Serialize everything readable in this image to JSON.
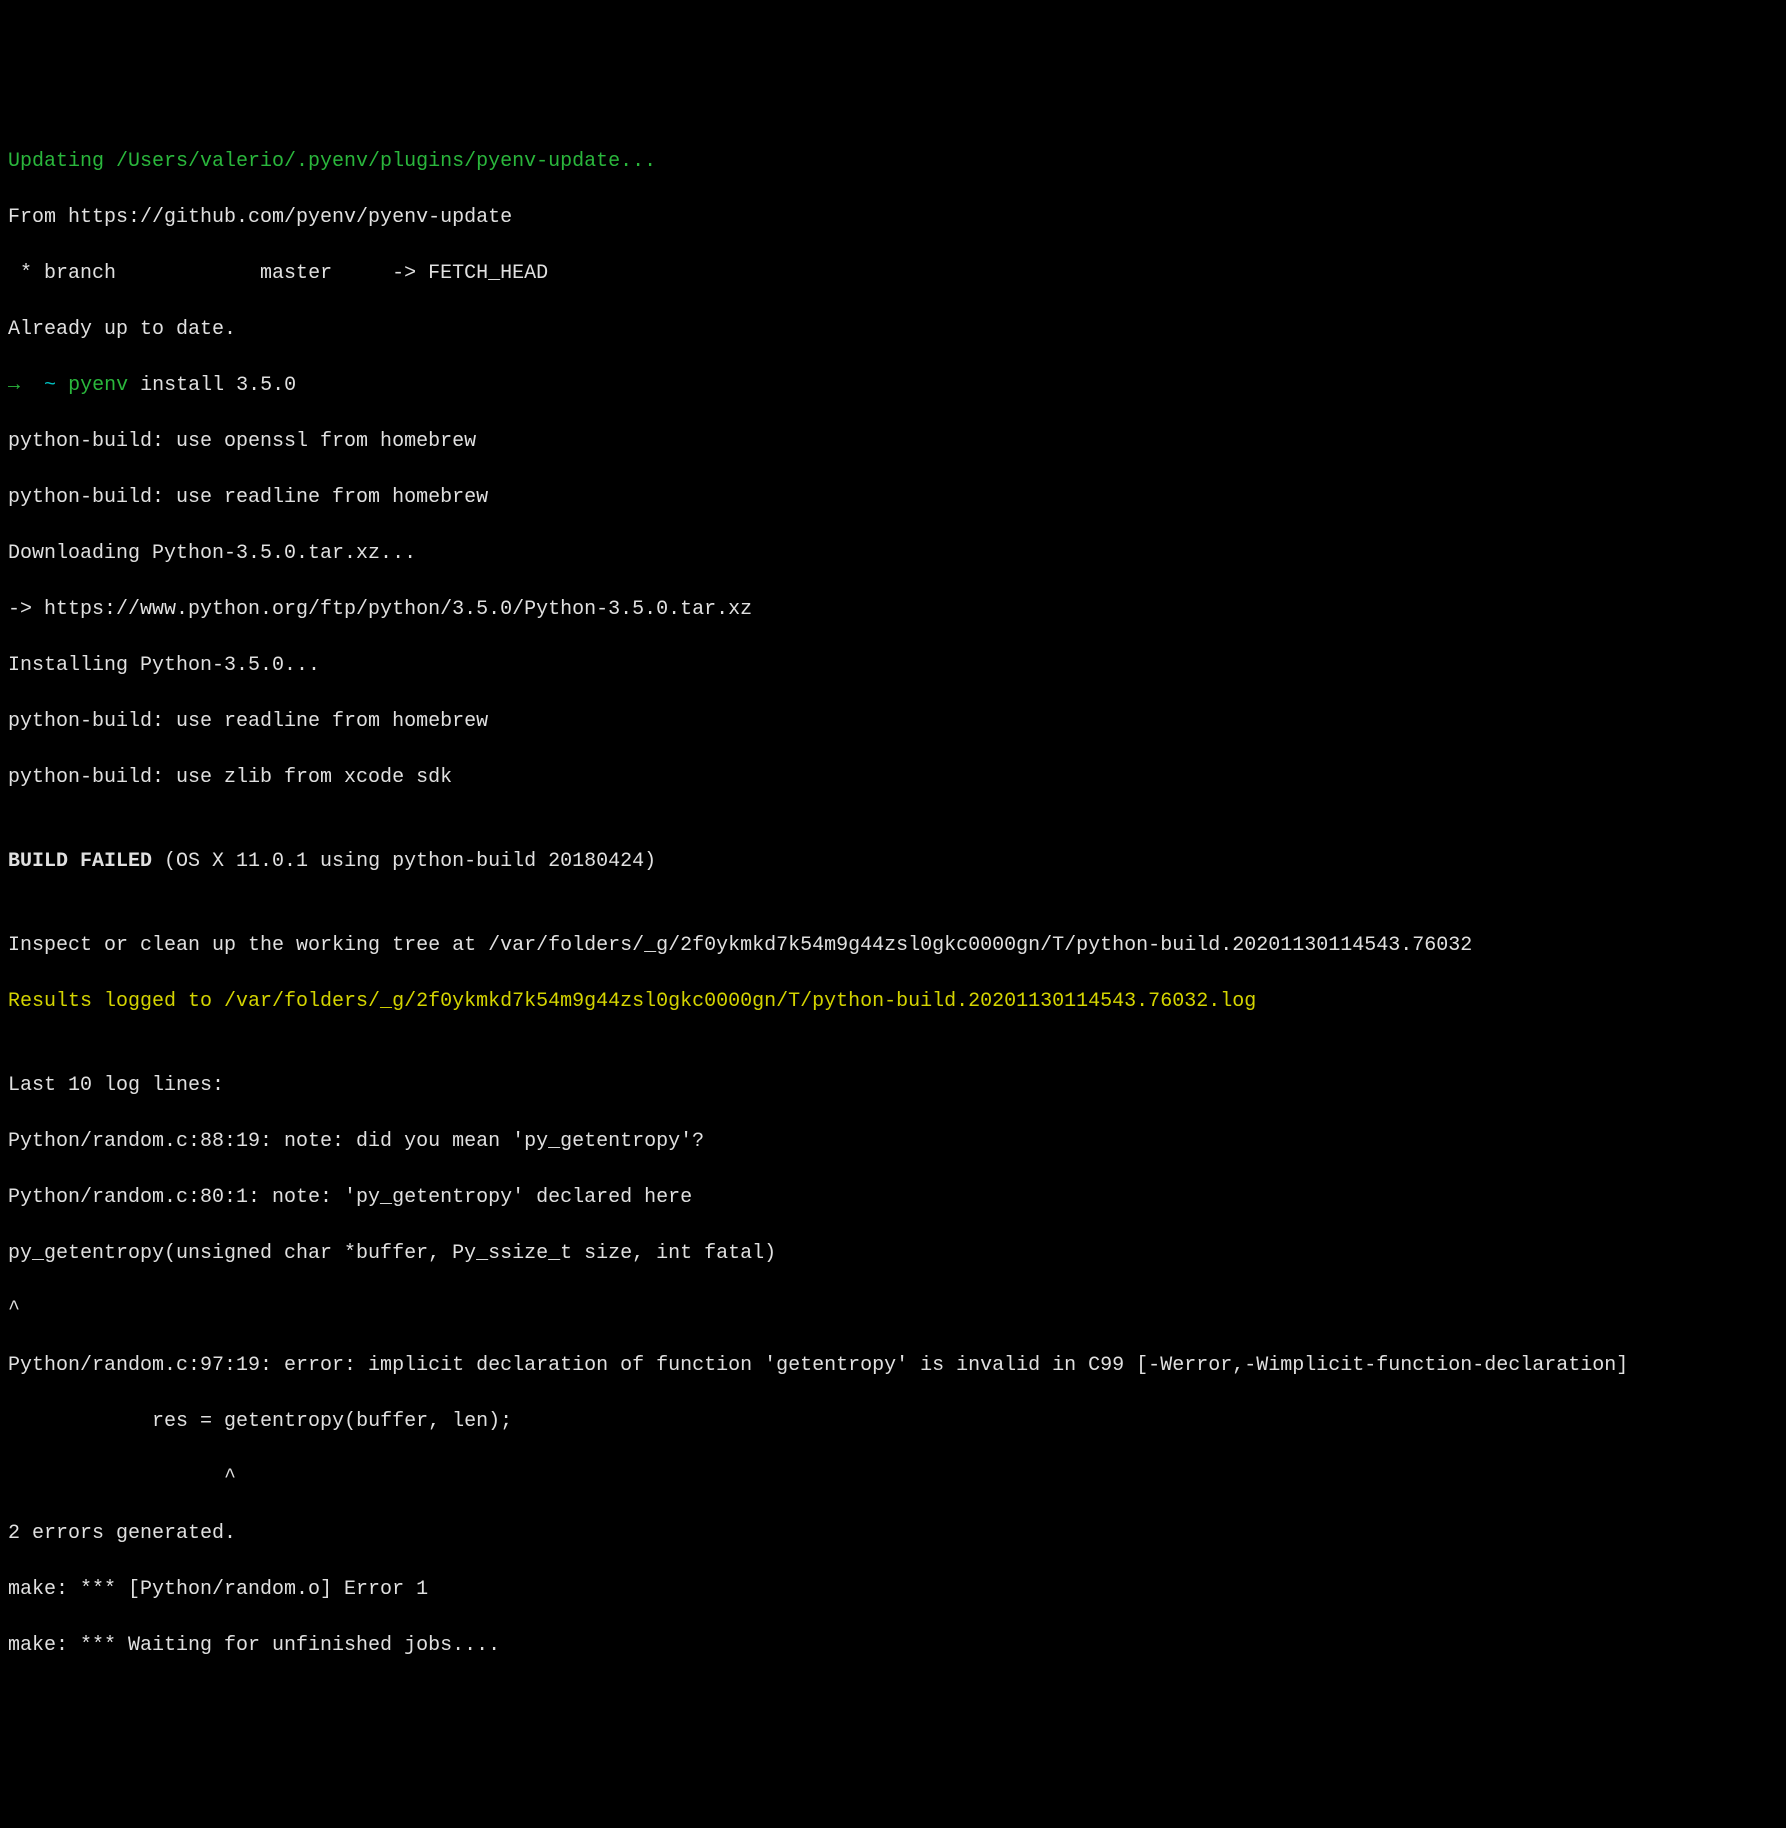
{
  "terminal": {
    "line1": "Updating /Users/valerio/.pyenv/plugins/pyenv-update...",
    "line2": "From https://github.com/pyenv/pyenv-update",
    "line3": " * branch            master     -> FETCH_HEAD",
    "line4": "Already up to date.",
    "prompt": {
      "arrow": "→",
      "tilde": "~",
      "cmd": "pyenv",
      "args": "install 3.5.0"
    },
    "line6": "python-build: use openssl from homebrew",
    "line7": "python-build: use readline from homebrew",
    "line8": "Downloading Python-3.5.0.tar.xz...",
    "line9": "-> https://www.python.org/ftp/python/3.5.0/Python-3.5.0.tar.xz",
    "line10": "Installing Python-3.5.0...",
    "line11": "python-build: use readline from homebrew",
    "line12": "python-build: use zlib from xcode sdk",
    "line13_blank": "",
    "build_failed_bold": "BUILD FAILED",
    "build_failed_rest": " (OS X 11.0.1 using python-build 20180424)",
    "line15_blank": "",
    "line16": "Inspect or clean up the working tree at /var/folders/_g/2f0ykmkd7k54m9g44zsl0gkc0000gn/T/python-build.20201130114543.76032",
    "line17": "Results logged to /var/folders/_g/2f0ykmkd7k54m9g44zsl0gkc0000gn/T/python-build.20201130114543.76032.log",
    "line18_blank": "",
    "line19": "Last 10 log lines:",
    "line20": "Python/random.c:88:19: note: did you mean 'py_getentropy'?",
    "line21": "Python/random.c:80:1: note: 'py_getentropy' declared here",
    "line22": "py_getentropy(unsigned char *buffer, Py_ssize_t size, int fatal)",
    "line23": "^",
    "line24": "Python/random.c:97:19: error: implicit declaration of function 'getentropy' is invalid in C99 [-Werror,-Wimplicit-function-declaration]",
    "line25": "            res = getentropy(buffer, len);",
    "line26": "                  ^",
    "line27": "2 errors generated.",
    "line28": "make: *** [Python/random.o] Error 1",
    "line29": "make: *** Waiting for unfinished jobs...."
  }
}
